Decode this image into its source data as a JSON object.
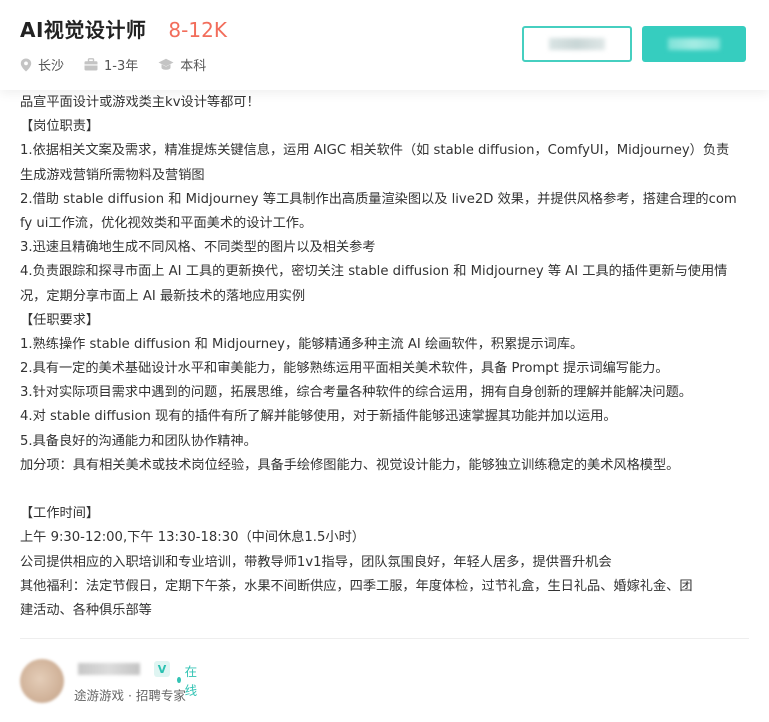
{
  "header": {
    "job_title": "AI视觉设计师",
    "salary": "8-12K",
    "location": "长沙",
    "experience": "1-3年",
    "education": "本科",
    "icons": [
      "location-pin-icon",
      "briefcase-icon",
      "graduation-cap-icon"
    ],
    "colors": {
      "salary": "#f26d5b",
      "accent": "#36cdbf"
    }
  },
  "description": {
    "lines": [
      "品宣平面设计或游戏类主kv设计等都可！",
      "【岗位职责】",
      "1.依据相关文案及需求，精准提炼关键信息，运用 AIGC 相关软件（如 stable diffusion，ComfyUI，Midjourney）负责",
      "生成游戏营销所需物料及营销图",
      "2.借助 stable diffusion 和 Midjourney 等工具制作出高质量渲染图以及 live2D 效果，并提供风格参考，搭建合理的com",
      "fy ui工作流，优化视效类和平面美术的设计工作。",
      "3.迅速且精确地生成不同风格、不同类型的图片以及相关参考",
      "4.负责跟踪和探寻市面上 AI 工具的更新换代，密切关注 stable diffusion 和 Midjourney 等 AI 工具的插件更新与使用情",
      "况，定期分享市面上 AI 最新技术的落地应用实例",
      "【任职要求】",
      "1.熟练操作 stable diffusion 和 Midjourney，能够精通多种主流 AI 绘画软件，积累提示词库。",
      "2.具有一定的美术基础设计水平和审美能力，能够熟练运用平面相关美术软件，具备 Prompt 提示词编写能力。",
      "3.针对实际项目需求中遇到的问题，拓展思维，综合考量各种软件的综合运用，拥有自身创新的理解并能解决问题。",
      "4.对 stable diffusion 现有的插件有所了解并能够使用，对于新插件能够迅速掌握其功能并加以运用。",
      "5.具备良好的沟通能力和团队协作精神。",
      "加分项：具有相关美术或技术岗位经验，具备手绘修图能力、视觉设计能力，能够独立训练稳定的美术风格模型。",
      "",
      "【工作时间】",
      "上午 9:30-12:00,下午 13:30-18:30（中间休息1.5小时）",
      "公司提供相应的入职培训和专业培训，带教导师1v1指导，团队氛围良好，年轻人居多，提供晋升机会",
      "其他福利：法定节假日，定期下午茶，水果不间断供应，四季工服，年度体检，过节礼盒，生日礼品、婚嫁礼金、团",
      "建活动、各种俱乐部等"
    ]
  },
  "recruiter": {
    "verified_badge": "V",
    "status": "在线",
    "company_role": "途游游戏 · 招聘专家",
    "colors": {
      "online": "#33c3b4"
    }
  }
}
